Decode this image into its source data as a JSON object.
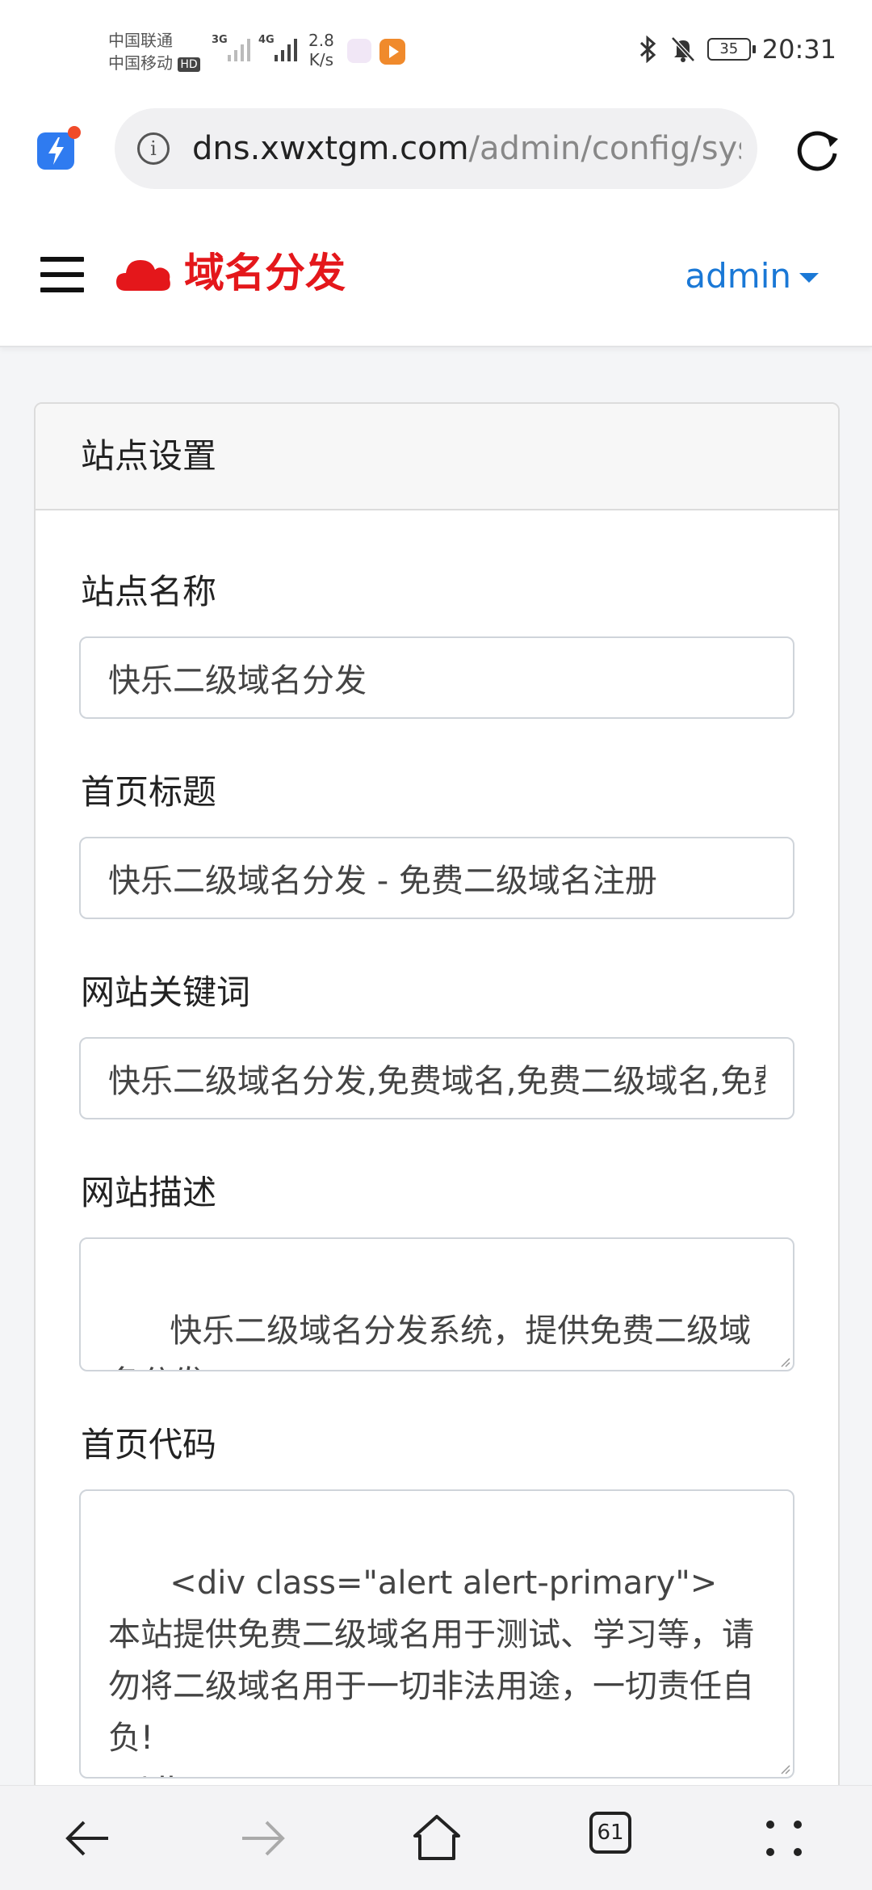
{
  "status_bar": {
    "carrier_1": "中国联通",
    "carrier_2": "中国移动",
    "hd_badge": "HD",
    "net_1": "3G",
    "net_2": "4G",
    "speed_value": "2.8",
    "speed_unit": "K/s",
    "battery": "35",
    "time": "20:31"
  },
  "browser": {
    "url_host": "dns.xwxtgm.com",
    "url_path": "/admin/config/sys"
  },
  "navbar": {
    "brand": "域名分发",
    "user": "admin"
  },
  "card": {
    "title": "站点设置",
    "fields": {
      "site_name": {
        "label": "站点名称",
        "value": "快乐二级域名分发"
      },
      "home_title": {
        "label": "首页标题",
        "value": "快乐二级域名分发 - 免费二级域名注册"
      },
      "keywords": {
        "label": "网站关键词",
        "value": "快乐二级域名分发,免费域名,免费二级域名,免费域名注册"
      },
      "description": {
        "label": "网站描述",
        "value": "快乐二级域名分发系统，提供免费二级域名分发"
      },
      "home_code": {
        "label": "首页代码",
        "value": "<div class=\"alert alert-primary\">\n本站提供免费二级域名用于测试、学习等，请勿将二级域名用于一切非法用途，一切责任自负!\n</div>"
      }
    }
  },
  "bottom_nav": {
    "tabs_count": "61"
  }
}
